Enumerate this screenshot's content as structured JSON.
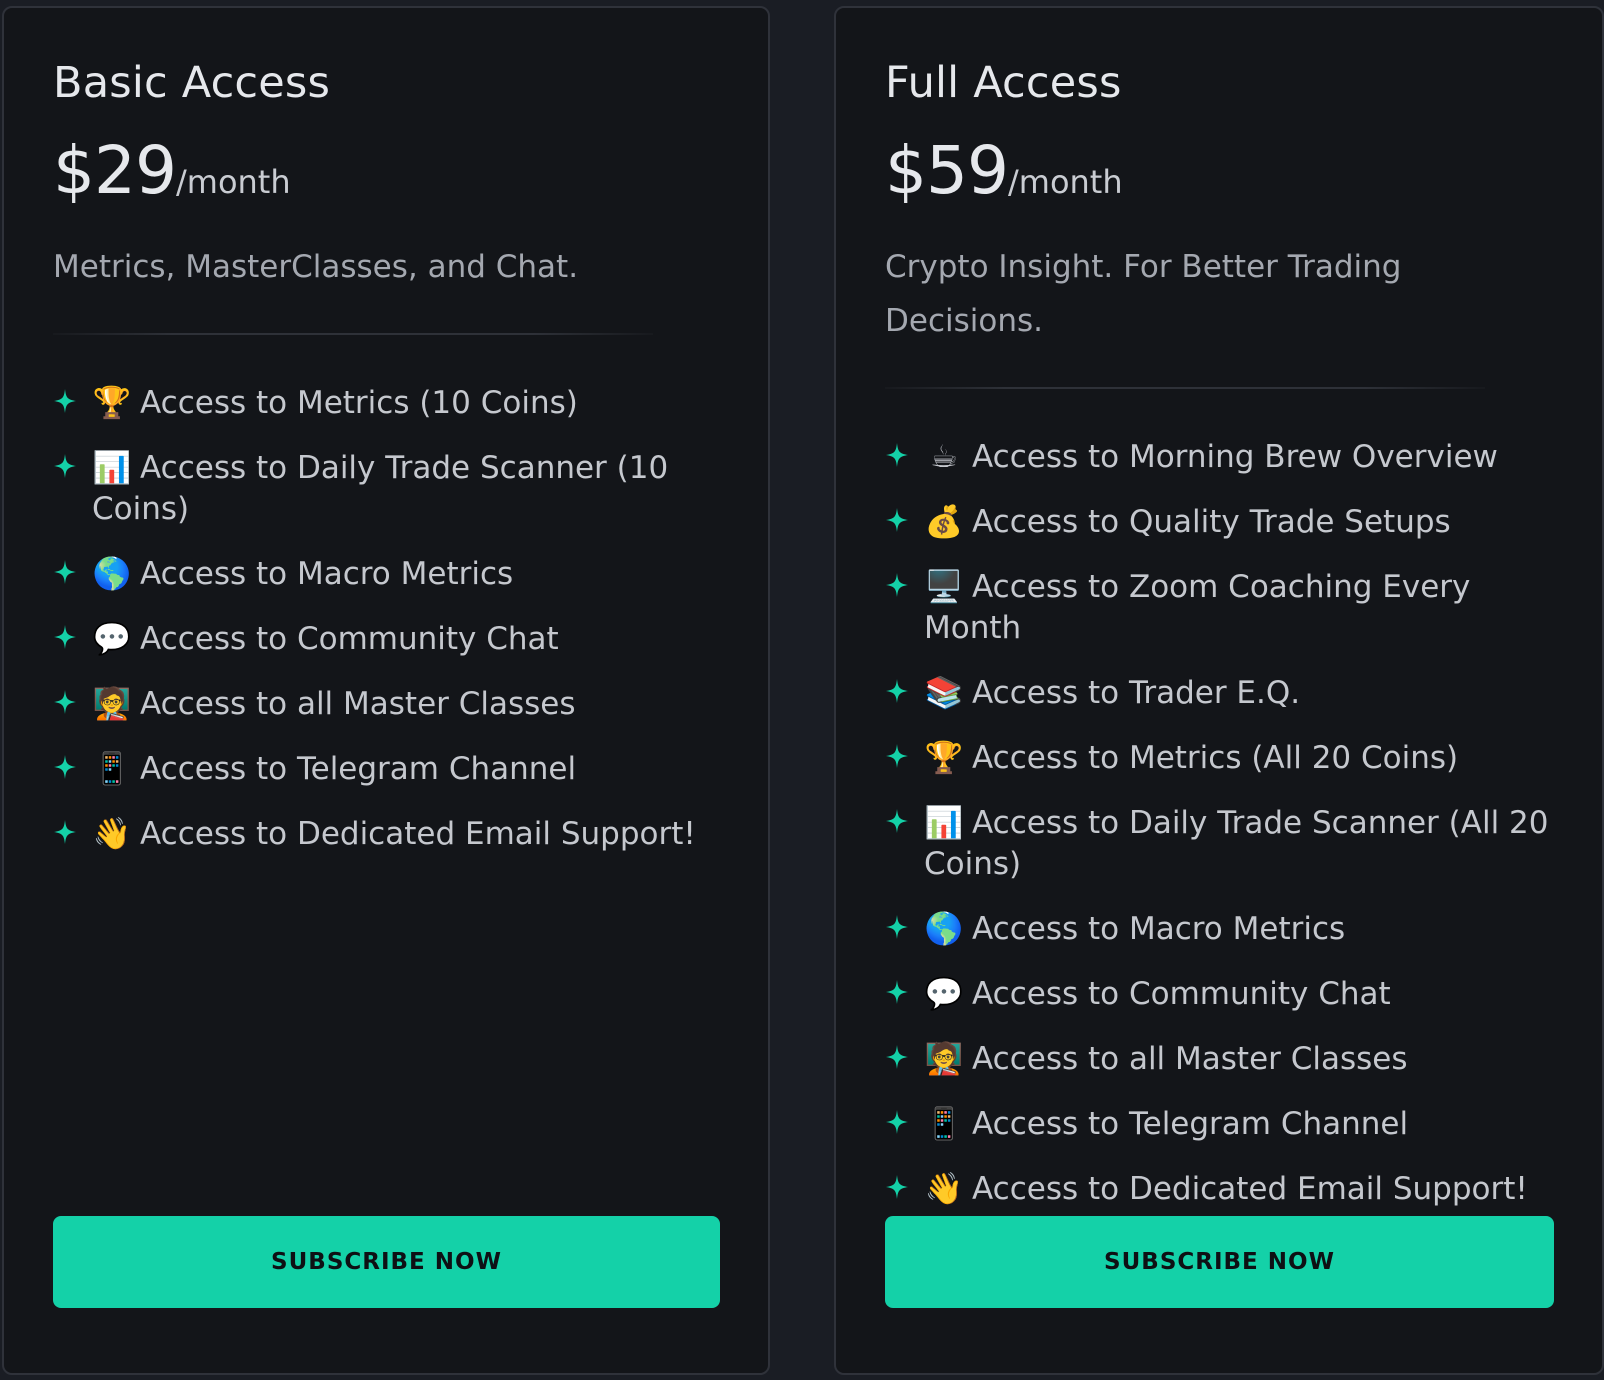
{
  "colors": {
    "accent": "#14d1a8",
    "card_background": "#131519",
    "page_background": "#1a1d24",
    "text_primary": "#e6e8ec",
    "text_muted": "#a4a8b0"
  },
  "plans": [
    {
      "title": "Basic Access",
      "price": "$29",
      "period": "/month",
      "tagline": "Metrics, MasterClasses, and Chat.",
      "features": [
        {
          "emoji": "🏆",
          "text": "Access to Metrics (10 Coins)"
        },
        {
          "emoji": "📊",
          "text": "Access to Daily Trade Scanner (10 Coins)"
        },
        {
          "emoji": "🌎",
          "text": "Access to Macro Metrics"
        },
        {
          "emoji": "💬",
          "text": "Access to Community Chat"
        },
        {
          "emoji": "🧑‍🏫",
          "text": "Access to all Master Classes"
        },
        {
          "emoji": "📱",
          "text": "Access to Telegram Channel"
        },
        {
          "emoji": "👋",
          "text": "Access to Dedicated Email Support!"
        }
      ],
      "button_label": "SUBSCRIBE NOW"
    },
    {
      "title": "Full Access",
      "price": "$59",
      "period": "/month",
      "tagline": "Crypto Insight. For Better Trading Decisions.",
      "features": [
        {
          "emoji": "☕",
          "text": "Access to Morning Brew Overview"
        },
        {
          "emoji": "💰",
          "text": "Access to Quality Trade Setups"
        },
        {
          "emoji": "🖥️",
          "text": "Access to Zoom Coaching Every Month"
        },
        {
          "emoji": "📚",
          "text": "Access to Trader E.Q."
        },
        {
          "emoji": "🏆",
          "text": "Access to Metrics (All 20 Coins)"
        },
        {
          "emoji": "📊",
          "text": "Access to Daily Trade Scanner (All 20 Coins)"
        },
        {
          "emoji": "🌎",
          "text": "Access to Macro Metrics"
        },
        {
          "emoji": "💬",
          "text": "Access to Community Chat"
        },
        {
          "emoji": "🧑‍🏫",
          "text": "Access to all Master Classes"
        },
        {
          "emoji": "📱",
          "text": "Access to Telegram Channel"
        },
        {
          "emoji": "👋",
          "text": "Access to Dedicated Email Support!"
        }
      ],
      "button_label": "SUBSCRIBE NOW"
    }
  ]
}
